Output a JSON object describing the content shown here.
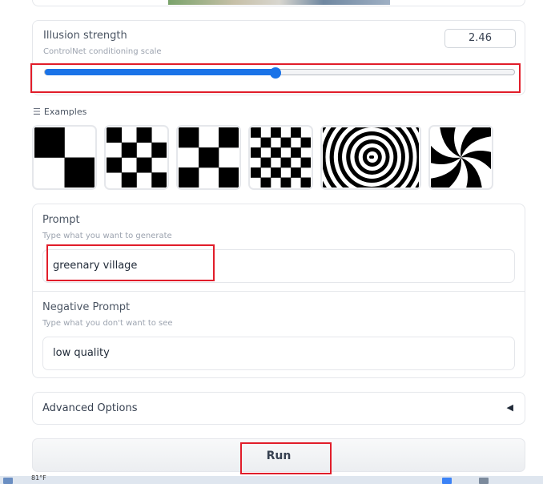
{
  "slider": {
    "label": "Illusion strength",
    "info": "ControlNet conditioning scale",
    "value": "2.46",
    "fraction": 0.492
  },
  "examples": {
    "label": "Examples",
    "icon": "list-icon",
    "items": [
      {
        "name": "checker-2x2",
        "type": "checker",
        "n": 2
      },
      {
        "name": "checker-4x4",
        "type": "checker",
        "n": 4
      },
      {
        "name": "checker-3x3",
        "type": "checker",
        "n": 3
      },
      {
        "name": "checker-6x6",
        "type": "checker",
        "n": 6
      },
      {
        "name": "spiral-rings",
        "type": "rings"
      },
      {
        "name": "spiral-swirl",
        "type": "swirl"
      }
    ]
  },
  "prompt": {
    "label": "Prompt",
    "info": "Type what you want to generate",
    "value": "greenary village"
  },
  "negative_prompt": {
    "label": "Negative Prompt",
    "info": "Type what you don't want to see",
    "value": "low quality"
  },
  "advanced": {
    "label": "Advanced Options",
    "icon": "caret-left-icon",
    "glyph": "◀"
  },
  "run": {
    "label": "Run"
  },
  "taskbar": {
    "text": "81°F"
  },
  "colors": {
    "accent": "#1a73e8",
    "highlight": "#e11d2a"
  }
}
